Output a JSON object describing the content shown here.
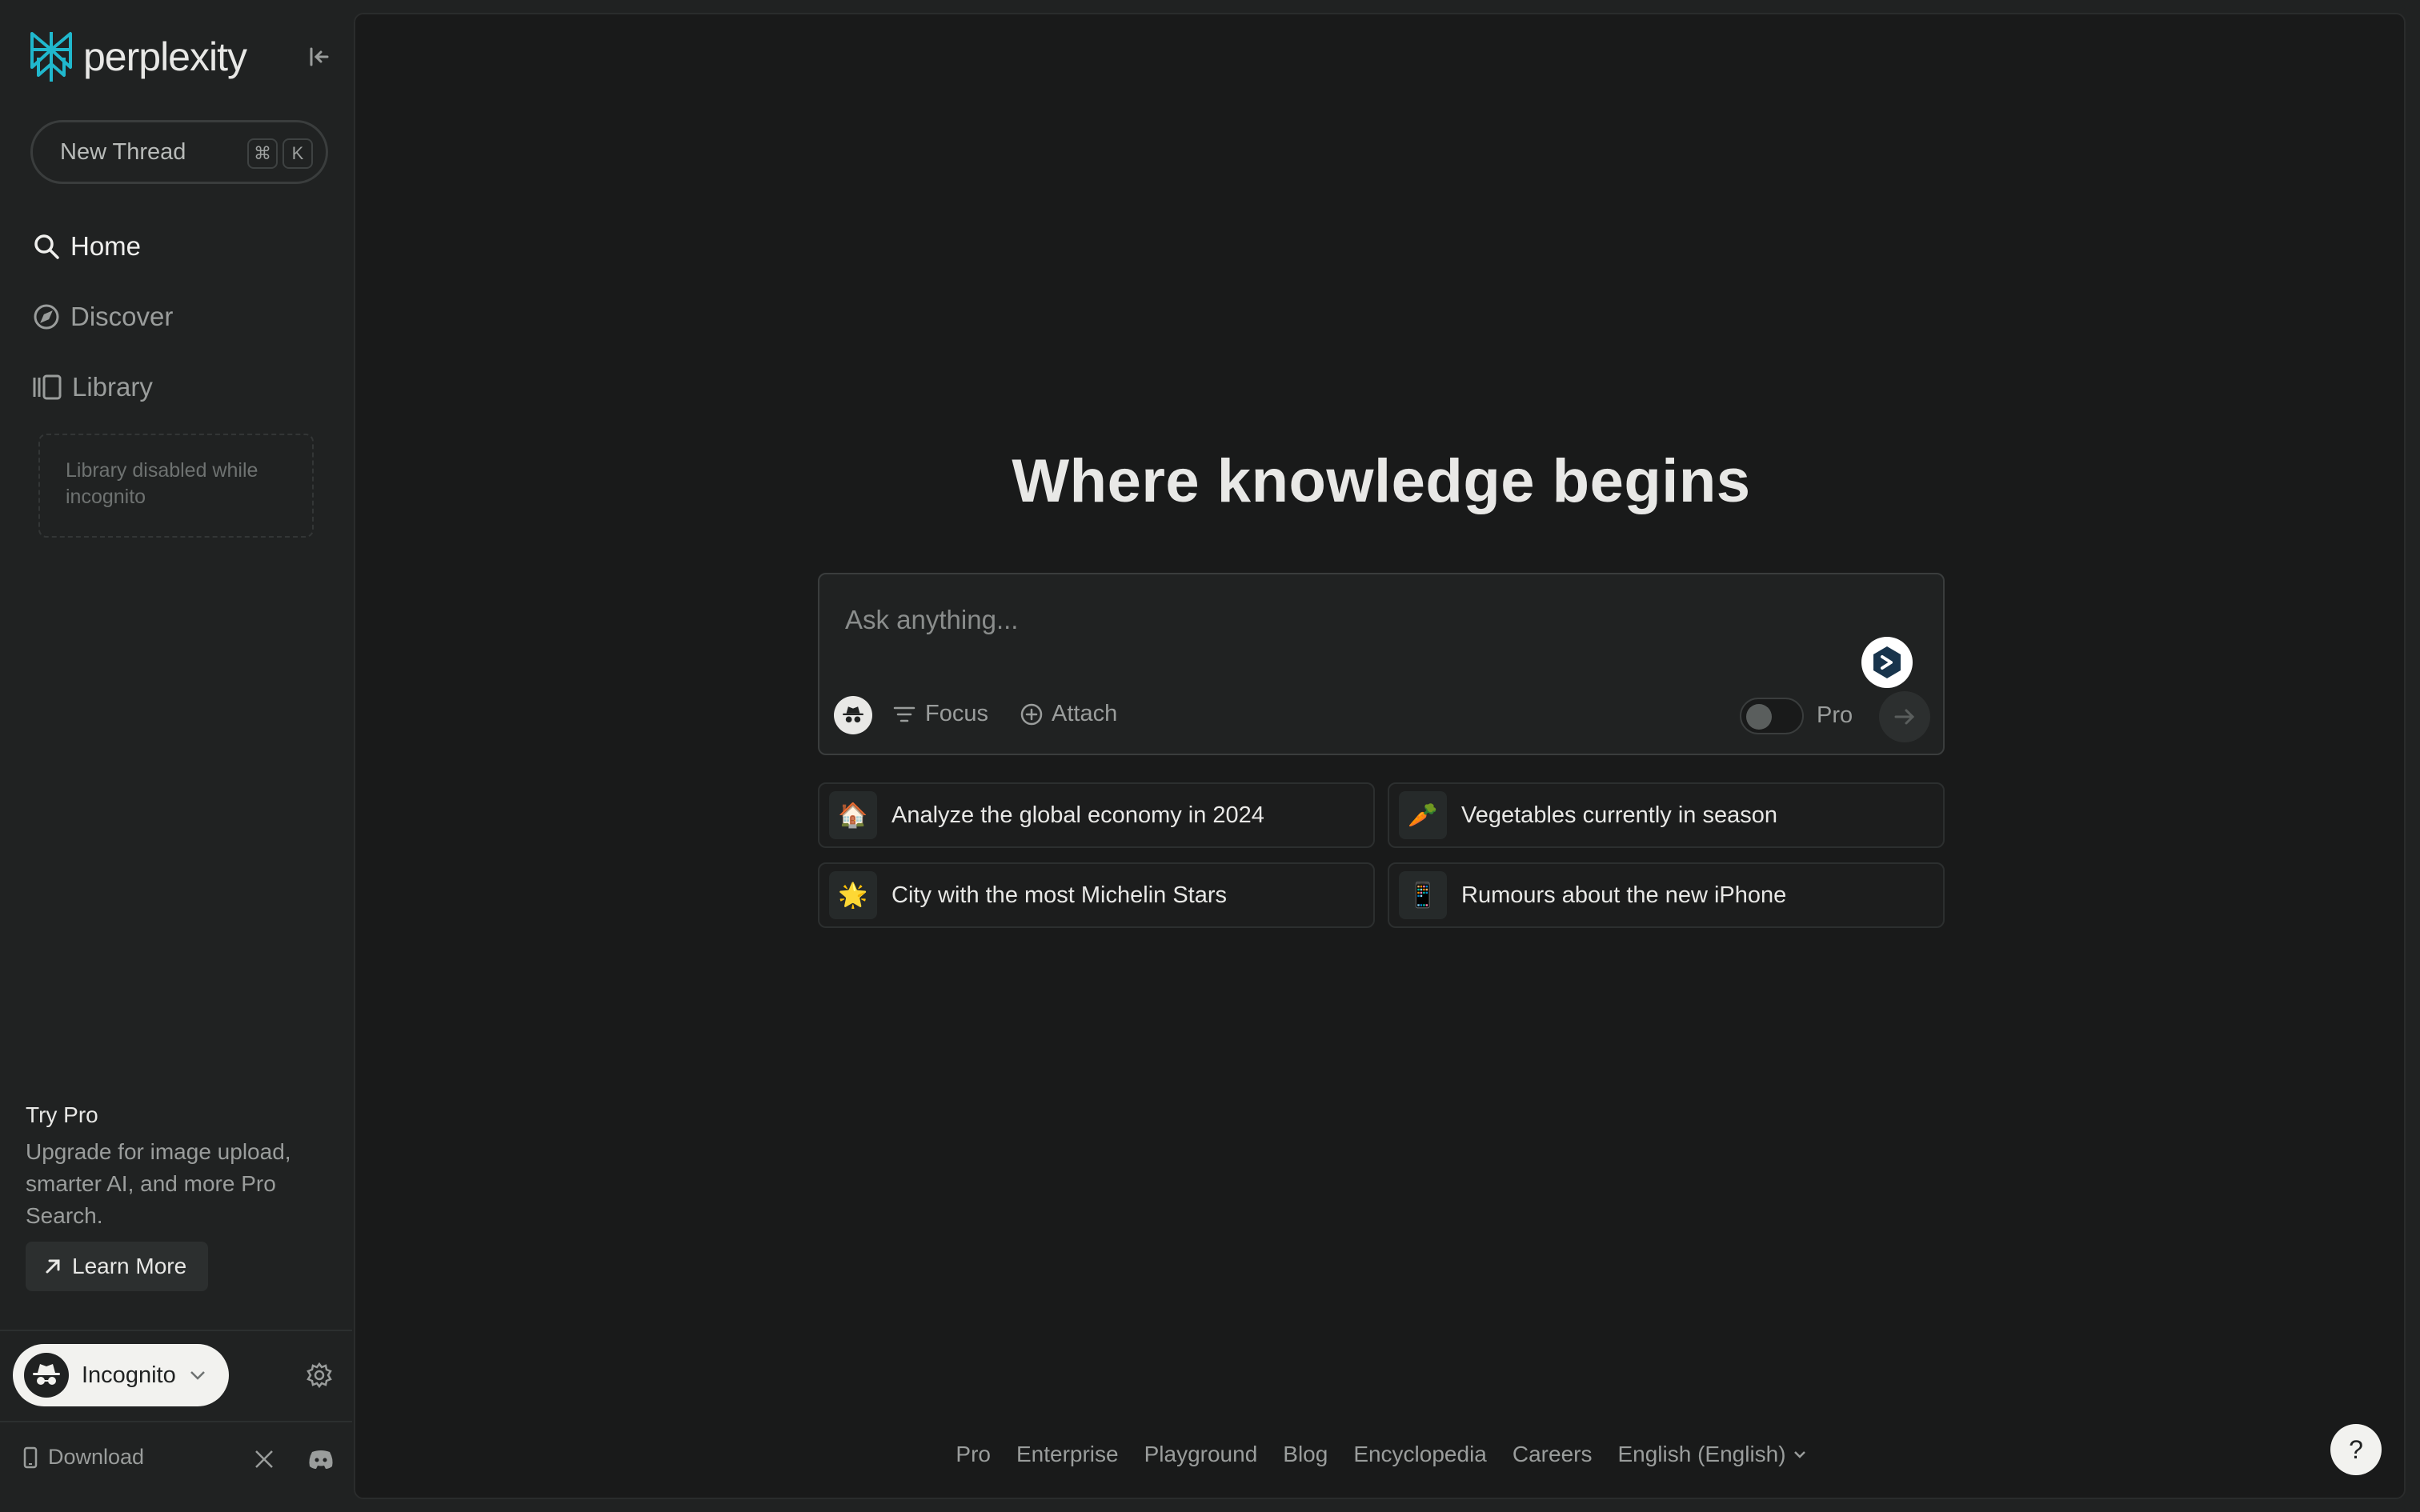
{
  "brand": {
    "name": "perplexity",
    "accent": "#20b8cd"
  },
  "sidebar": {
    "new_thread_label": "New Thread",
    "shortcut_cmd": "⌘",
    "shortcut_key": "K",
    "nav": [
      {
        "label": "Home",
        "icon": "search-icon",
        "active": true
      },
      {
        "label": "Discover",
        "icon": "compass-icon",
        "active": false
      },
      {
        "label": "Library",
        "icon": "library-icon",
        "active": false
      }
    ],
    "library_note": "Library disabled while incognito",
    "try_pro": {
      "title": "Try Pro",
      "desc": "Upgrade for image upload, smarter AI, and more Pro Search.",
      "button": "Learn More"
    },
    "account": {
      "label": "Incognito"
    },
    "download_label": "Download"
  },
  "main": {
    "headline": "Where knowledge begins",
    "ask_placeholder": "Ask anything...",
    "focus_label": "Focus",
    "attach_label": "Attach",
    "pro_label": "Pro",
    "pro_enabled": false,
    "suggestions": [
      {
        "emoji": "🏠",
        "label": "Analyze the global economy in 2024"
      },
      {
        "emoji": "🥕",
        "label": "Vegetables currently in season"
      },
      {
        "emoji": "🌟",
        "label": "City with the most Michelin Stars"
      },
      {
        "emoji": "📱",
        "label": "Rumours about the new iPhone"
      }
    ],
    "footer": [
      "Pro",
      "Enterprise",
      "Playground",
      "Blog",
      "Encyclopedia",
      "Careers"
    ],
    "language": "English (English)",
    "help_label": "?"
  }
}
